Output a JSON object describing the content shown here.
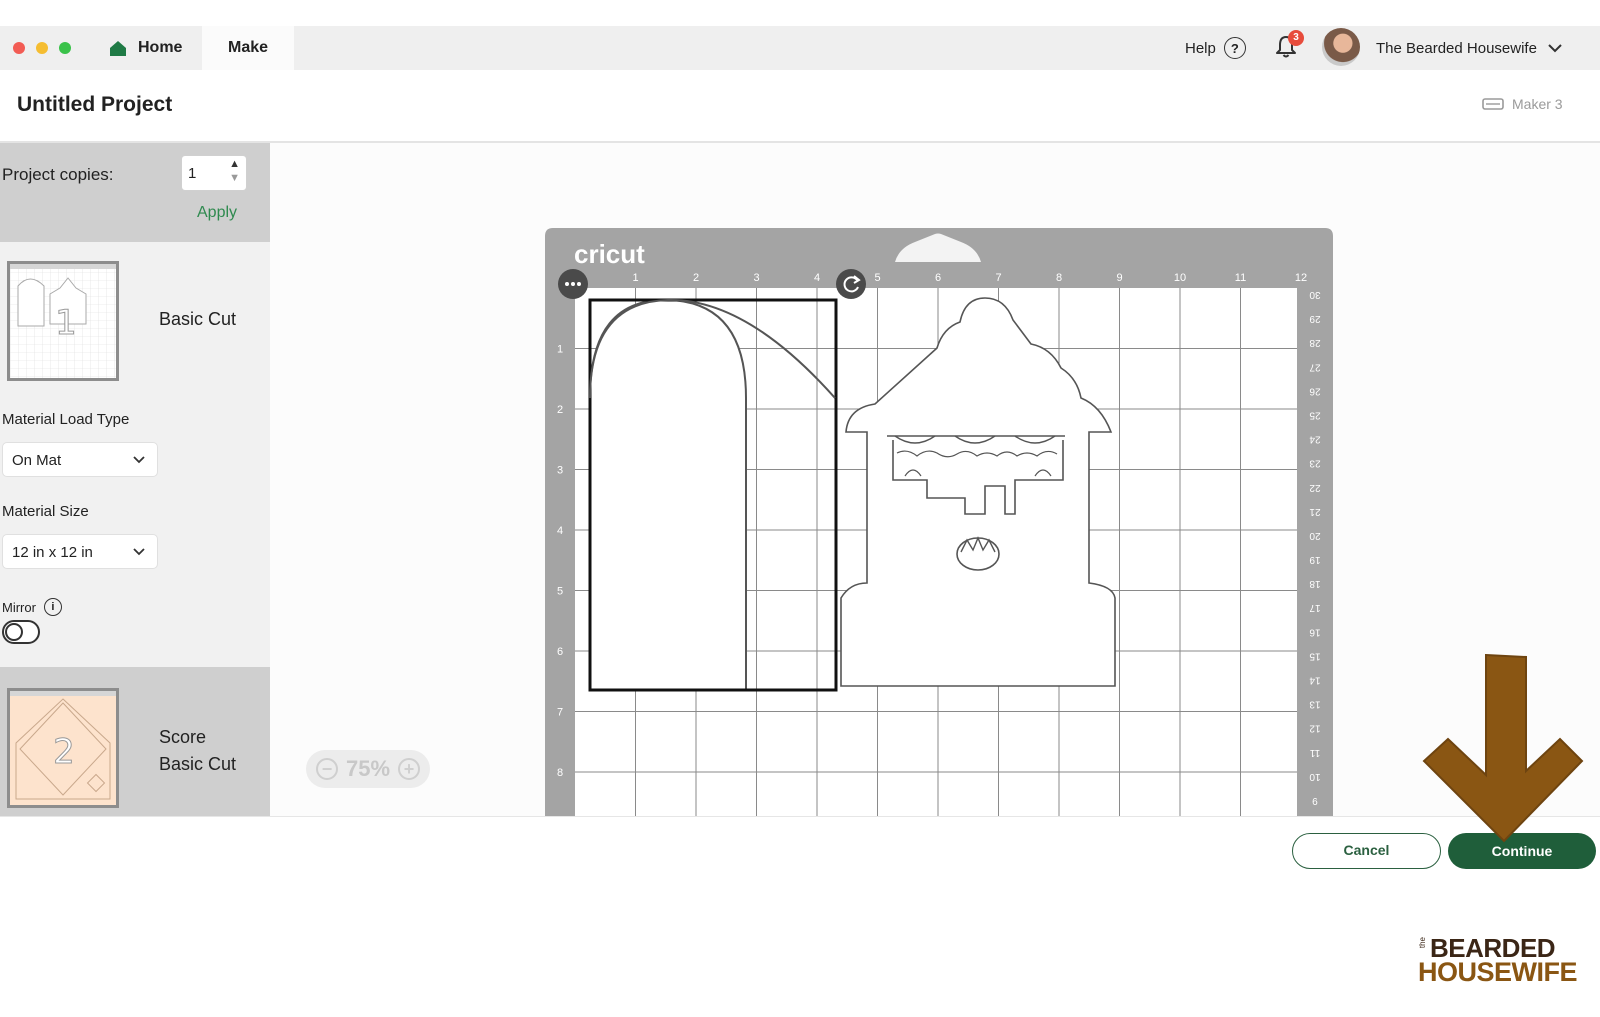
{
  "nav": {
    "tabs": [
      {
        "label": "Home"
      },
      {
        "label": "Make"
      }
    ],
    "help_label": "Help",
    "help_symbol": "?",
    "notifications_count": "3",
    "user_name": "The Bearded Housewife"
  },
  "project": {
    "title": "Untitled Project",
    "machine": "Maker 3"
  },
  "left_panel": {
    "copies_label": "Project copies:",
    "copies_value": "1",
    "apply_label": "Apply",
    "mats": [
      {
        "number": "1",
        "label": "Basic Cut"
      },
      {
        "number": "2",
        "label_line1": "Score",
        "label_line2": "Basic Cut"
      }
    ],
    "material_load_type_label": "Material Load Type",
    "material_load_type_value": "On Mat",
    "material_size_label": "Material Size",
    "material_size_value": "12 in x 12 in",
    "mirror_label": "Mirror",
    "mirror_on": false
  },
  "canvas": {
    "brand": "cricut",
    "zoom": "75%",
    "top_ruler": [
      "1",
      "2",
      "3",
      "4",
      "5",
      "6",
      "7",
      "8",
      "9",
      "10",
      "11",
      "12"
    ],
    "left_ruler": [
      "1",
      "2",
      "3",
      "4",
      "5",
      "6",
      "7",
      "8"
    ],
    "right_ruler": [
      "30",
      "29",
      "28",
      "27",
      "26",
      "25",
      "24",
      "23",
      "22",
      "21",
      "20",
      "19",
      "18",
      "17",
      "16",
      "15",
      "14",
      "13",
      "12",
      "11",
      "10",
      "9"
    ]
  },
  "footer": {
    "cancel_label": "Cancel",
    "continue_label": "Continue"
  },
  "watermark": {
    "small": "the",
    "line1": "BEARDED",
    "line2": "HOUSEWIFE"
  },
  "colors": {
    "accent_green": "#1f5e3a",
    "arrow_brown": "#8a5613",
    "notification_red": "#e74c3c"
  }
}
